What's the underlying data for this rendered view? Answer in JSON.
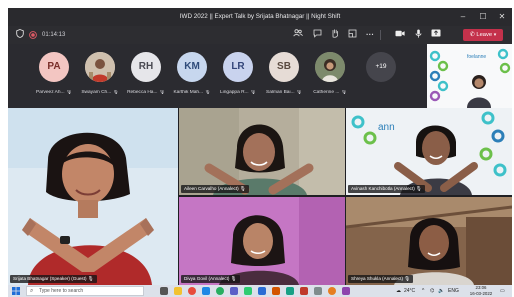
{
  "window": {
    "title": "IWD 2022 || Expert Talk by Srijata Bhatnagar || Night Shift"
  },
  "toolbar": {
    "timer": "01:14:13",
    "leave_label": "Leave",
    "colors": {
      "leave": "#c4314b"
    }
  },
  "participants": [
    {
      "initials": "PA",
      "name": "Parveez Ah...",
      "bg": "#f3c6c2",
      "fg": "#7a2f2a"
    },
    {
      "initials": "",
      "name": "Swayam Ch...",
      "bg": "#d9c8b4",
      "fg": "#333"
    },
    {
      "initials": "RH",
      "name": "Rebecca Ha...",
      "bg": "#e6e6ea",
      "fg": "#4a4a52"
    },
    {
      "initials": "KM",
      "name": "Karthik Mah...",
      "bg": "#c7d7ee",
      "fg": "#2f4c7a"
    },
    {
      "initials": "LR",
      "name": "Lingappa R...",
      "bg": "#c9d3ee",
      "fg": "#34467a"
    },
    {
      "initials": "SB",
      "name": "Salman Bai...",
      "bg": "#e6dcd6",
      "fg": "#5a4a40"
    },
    {
      "initials": "",
      "name": "Catherine ...",
      "bg": "#8b8a7c",
      "fg": "#fff"
    }
  ],
  "more_count": "+19",
  "videos": [
    {
      "name": "Srijata Bhatnagar (Speaker) (Guest)"
    },
    {
      "name": "Aileen Carvalho (Annalect)"
    },
    {
      "name": "Avinash Kanchibotla (Annalect)"
    },
    {
      "name": "Divya Govil (Annalect)"
    },
    {
      "name": "Shreya Shukla (Annalect)"
    }
  ],
  "taskbar": {
    "search_placeholder": "Type here to search",
    "temperature": "24°C",
    "language": "ENG",
    "time": "23:06",
    "date": "16-03-2022"
  }
}
